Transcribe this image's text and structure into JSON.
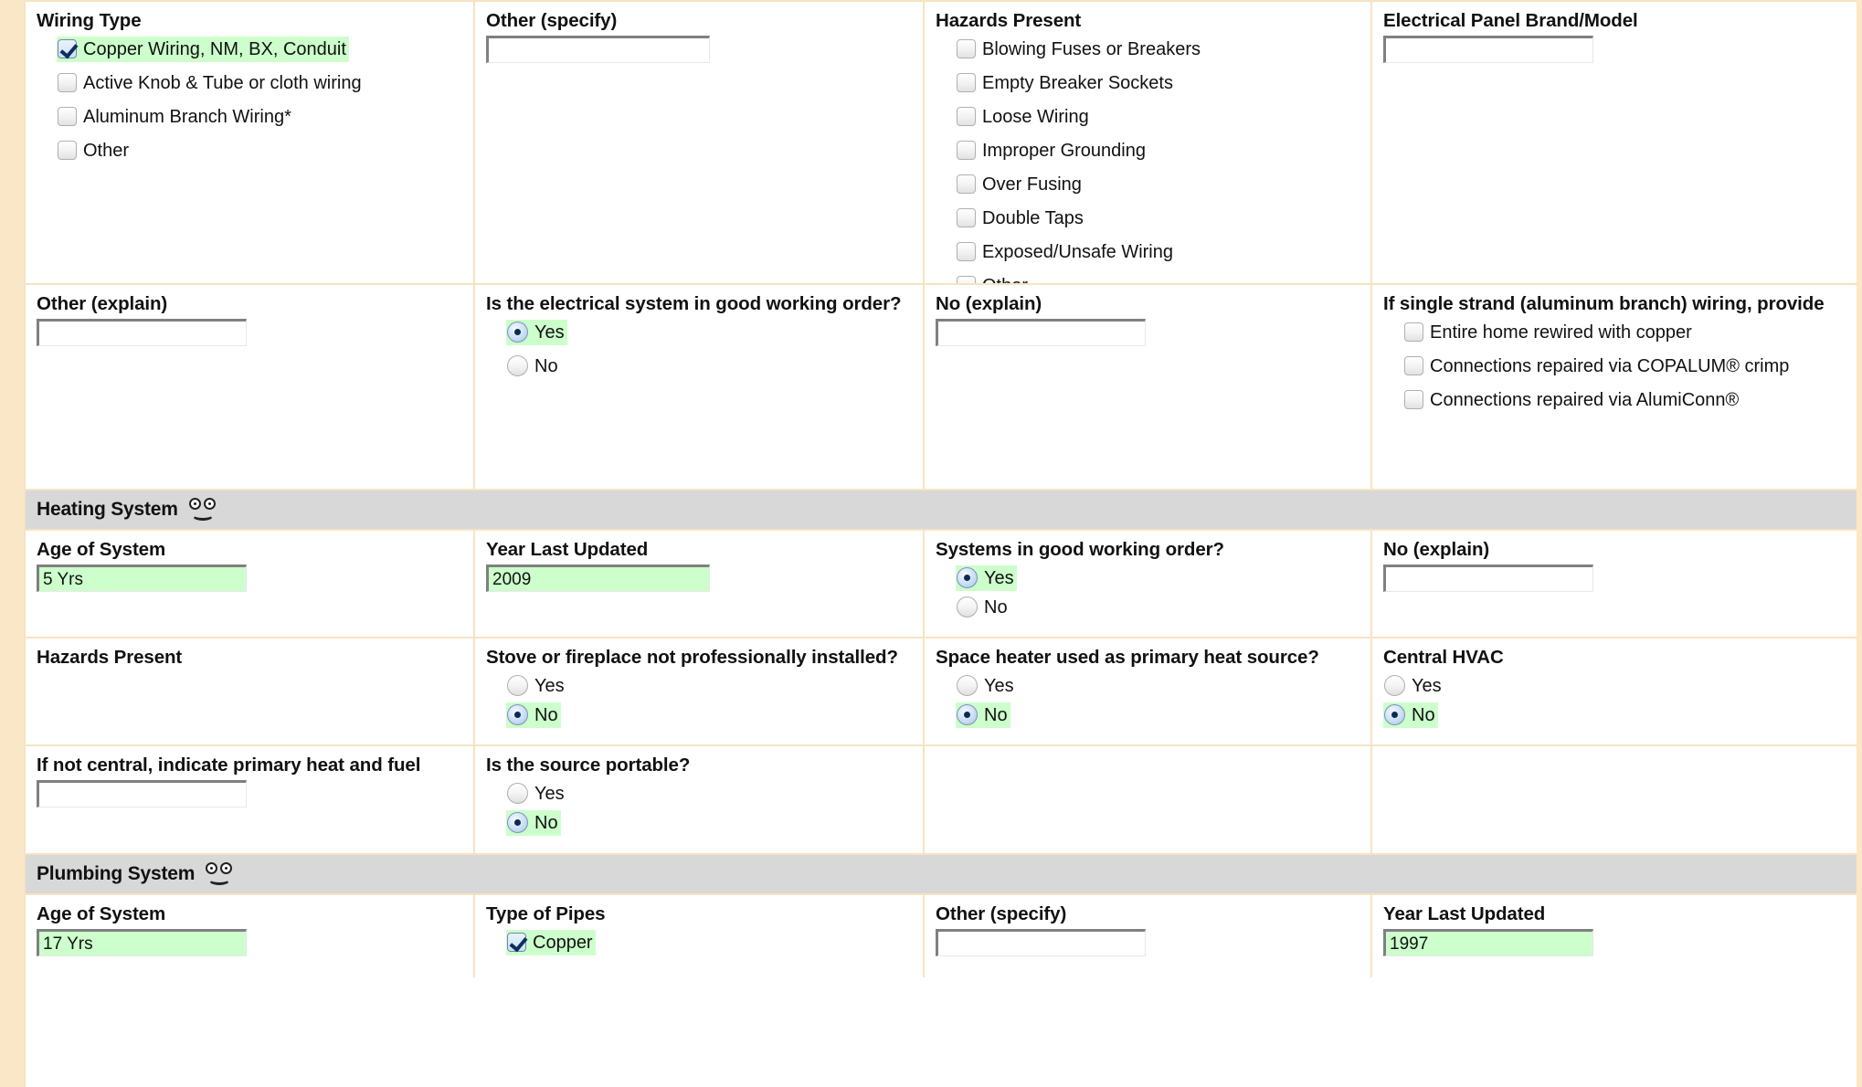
{
  "theme": {
    "border_color": "#f7e3c2",
    "highlight_color": "#ccffcc",
    "section_band_color": "#d8d8d8",
    "margin_strip_color": "#fae7c8"
  },
  "electrical": {
    "row1": {
      "wiring_type": {
        "label": "Wiring Type",
        "options": [
          {
            "text": "Copper Wiring, NM, BX, Conduit",
            "checked": true,
            "highlighted": true
          },
          {
            "text": "Active Knob & Tube or cloth wiring",
            "checked": false,
            "highlighted": false
          },
          {
            "text": "Aluminum Branch Wiring*",
            "checked": false,
            "highlighted": false
          },
          {
            "text": "Other",
            "checked": false,
            "highlighted": false
          }
        ]
      },
      "other_specify": {
        "label": "Other (specify)",
        "value": "",
        "placeholder": ""
      },
      "hazards_present": {
        "label": "Hazards Present",
        "options": [
          {
            "text": "Blowing Fuses or Breakers",
            "checked": false
          },
          {
            "text": "Empty Breaker Sockets",
            "checked": false
          },
          {
            "text": "Loose Wiring",
            "checked": false
          },
          {
            "text": "Improper Grounding",
            "checked": false
          },
          {
            "text": "Over Fusing",
            "checked": false
          },
          {
            "text": "Double Taps",
            "checked": false
          },
          {
            "text": "Exposed/Unsafe Wiring",
            "checked": false
          },
          {
            "text": "Other",
            "checked": false
          }
        ]
      },
      "panel_brand": {
        "label": "Electrical Panel Brand/Model",
        "value": "",
        "placeholder": ""
      }
    },
    "row2": {
      "other_explain": {
        "label": "Other (explain)",
        "value": "",
        "placeholder": ""
      },
      "good_working_order": {
        "label": "Is the electrical system in good working order?",
        "options": [
          {
            "text": "Yes",
            "selected": true,
            "highlighted": true
          },
          {
            "text": "No",
            "selected": false,
            "highlighted": false
          }
        ]
      },
      "no_explain": {
        "label": "No (explain)",
        "value": "",
        "placeholder": ""
      },
      "single_strand": {
        "label": "If single strand (aluminum branch) wiring, provide",
        "options": [
          {
            "text": "Entire home rewired with copper",
            "checked": false
          },
          {
            "text": "Connections repaired via COPALUM® crimp",
            "checked": false
          },
          {
            "text": "Connections repaired via AlumiConn®",
            "checked": false
          }
        ]
      }
    }
  },
  "heating": {
    "section_title": "Heating System",
    "section_icon": "smiley-face-icon",
    "row1": {
      "age_of_system": {
        "label": "Age of System",
        "value": "5 Yrs",
        "filled": true
      },
      "year_last_updated": {
        "label": "Year Last Updated",
        "value": "2009",
        "filled": true
      },
      "good_working_order": {
        "label": "Systems in good working order?",
        "options": [
          {
            "text": "Yes",
            "selected": true,
            "highlighted": true
          },
          {
            "text": "No",
            "selected": false,
            "highlighted": false
          }
        ]
      },
      "no_explain": {
        "label": "No (explain)",
        "value": "",
        "filled": false
      }
    },
    "row2": {
      "hazards_present": {
        "label": "Hazards Present"
      },
      "stove_fireplace": {
        "label": "Stove or fireplace not professionally installed?",
        "options": [
          {
            "text": "Yes",
            "selected": false,
            "highlighted": false
          },
          {
            "text": "No",
            "selected": true,
            "highlighted": true
          }
        ]
      },
      "space_heater": {
        "label": "Space heater used as primary heat source?",
        "options": [
          {
            "text": "Yes",
            "selected": false,
            "highlighted": false
          },
          {
            "text": "No",
            "selected": true,
            "highlighted": true
          }
        ]
      },
      "central_hvac": {
        "label": "Central HVAC",
        "options": [
          {
            "text": "Yes",
            "selected": false,
            "highlighted": false
          },
          {
            "text": "No",
            "selected": true,
            "highlighted": true
          }
        ]
      }
    },
    "row3": {
      "primary_heat_fuel": {
        "label": "If not central, indicate primary heat and fuel",
        "value": "",
        "filled": false
      },
      "source_portable": {
        "label": "Is the source portable?",
        "options": [
          {
            "text": "Yes",
            "selected": false,
            "highlighted": false
          },
          {
            "text": "No",
            "selected": true,
            "highlighted": true
          }
        ]
      }
    }
  },
  "plumbing": {
    "section_title": "Plumbing System",
    "section_icon": "smiley-face-icon",
    "row1": {
      "age_of_system": {
        "label": "Age of System",
        "value": "17 Yrs",
        "filled": true
      },
      "type_of_pipes": {
        "label": "Type of Pipes",
        "options": [
          {
            "text": "Copper",
            "checked": true,
            "highlighted": true
          }
        ]
      },
      "other_specify": {
        "label": "Other (specify)",
        "value": "",
        "filled": false
      },
      "year_last_updated": {
        "label": "Year Last Updated",
        "value": "1997",
        "filled": true
      }
    }
  }
}
